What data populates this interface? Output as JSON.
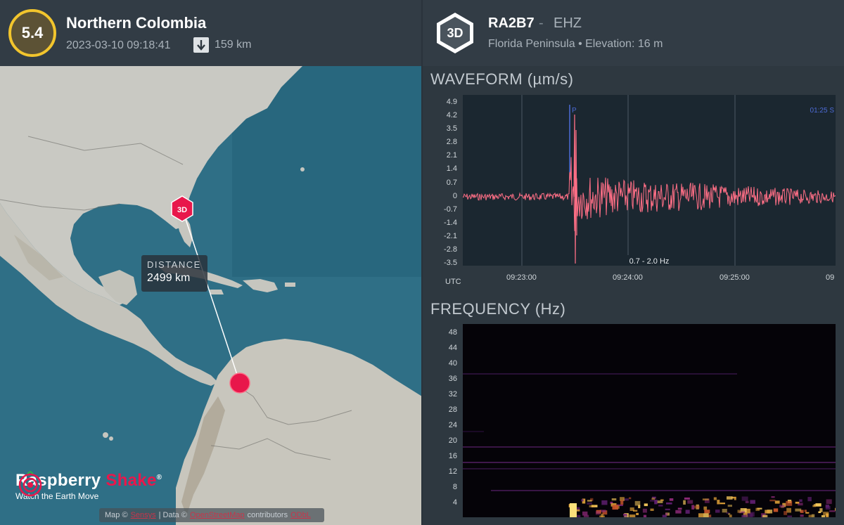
{
  "event": {
    "magnitude": "5.4",
    "region": "Northern Colombia",
    "datetime": "2023-03-10 09:18:41",
    "depth": "159 km"
  },
  "map": {
    "station_badge": "3D",
    "distance_label": "DISTANCE",
    "distance_value": "2499 km",
    "brand": {
      "name_main": "Raspberry ",
      "name_accent": "Shake",
      "reg": "®",
      "tagline": "Watch the Earth Move"
    },
    "attribution": {
      "map_prefix": "Map ©",
      "map_link": "Sensys",
      "data_prefix": "| Data ©",
      "data_link": "OpenStreetMap",
      "contrib": "contributors",
      "contrib_link": "ODbL"
    }
  },
  "station": {
    "badge": "3D",
    "code": "RA2B7",
    "separator": "-",
    "channel": "EHZ",
    "location": "Florida Peninsula • Elevation: 16 m"
  },
  "waveform": {
    "title": "WAVEFORM (µm/s)",
    "y_ticks": [
      "4.9",
      "4.2",
      "3.5",
      "2.8",
      "2.1",
      "1.4",
      "0.7",
      "0",
      "-0.7",
      "-1.4",
      "-2.1",
      "-2.8",
      "-3.5"
    ],
    "x_ticks": [
      "09:23:00",
      "09:24:00",
      "09:25:00",
      "09"
    ],
    "x_unit": "UTC",
    "p_marker": "P",
    "s_marker": "01:25  S",
    "filter": "0.7 - 2.0 Hz"
  },
  "frequency": {
    "title": "FREQUENCY (Hz)",
    "y_ticks": [
      "48",
      "44",
      "40",
      "36",
      "32",
      "28",
      "24",
      "20",
      "16",
      "12",
      "8",
      "4"
    ]
  },
  "colors": {
    "accent": "#e8174b",
    "magnitude_ring": "#f2c52d",
    "trace": "#ff6f86"
  }
}
